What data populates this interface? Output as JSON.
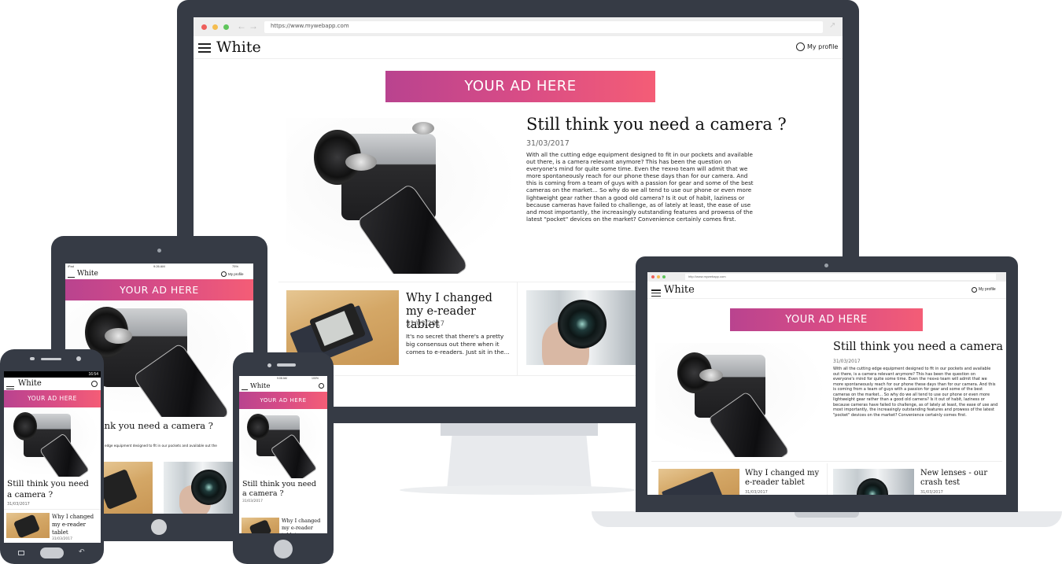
{
  "background_color": "#ffffff",
  "accent": {
    "ad_gradient_start": "#b9438f",
    "ad_gradient_end": "#f45d76",
    "device_frame": "#363b45"
  },
  "desktop": {
    "browser": {
      "url": "https://www.mywebapp.com",
      "traffic_lights": [
        "#ee5f5b",
        "#f5bd4f",
        "#5fc55b"
      ]
    },
    "header": {
      "brand": "White",
      "profile_label": "My profile"
    },
    "ad": {
      "label": "YOUR AD HERE"
    },
    "featured": {
      "title": "Still think you need a camera ?",
      "date": "31/03/2017",
      "body": "With all the cutting edge equipment designed to fit in our pockets and available out there, is a camera relevant anymore? This has been the question on everyone's mind for quite some time. Even the техно team will admit that we more spontaneously reach for our phone these days than for our camera. And this is coming from a team of guys with a passion for gear and some of the best cameras on the market... So why do we all tend to use our phone or even more lightweight gear rather than a good old camera? Is it out of habit, laziness or because cameras have failed to challenge, as of lately at least, the ease of use and most importantly, the increasingly outstanding features and prowess of the latest \"pocket\" devices on the market? Convenience certainly comes first."
    },
    "cards": [
      {
        "title": "Why I changed my e-reader tablet",
        "date": "31/03/2017",
        "excerpt": "It's no secret that there's a pretty big consensus out there when it comes to e-readers. Just sit in the..."
      }
    ]
  },
  "laptop": {
    "browser": {
      "url": "http://www.mywebapp.com"
    },
    "header": {
      "brand": "White",
      "profile_label": "My profile"
    },
    "ad": {
      "label": "YOUR AD HERE"
    },
    "featured": {
      "title": "Still think you need a camera ?",
      "date": "31/03/2017",
      "body": "With all the cutting edge equipment designed to fit in our pockets and available out there, is a camera relevant anymore? This has been the question on everyone's mind for quite some time. Even the техно team will admit that we more spontaneously reach for our phone these days than for our camera. And this is coming from a team of guys with a passion for gear and some of the best cameras on the market... So why do we all tend to use our phone or even more lightweight gear rather than a good old camera? Is it out of habit, laziness or because cameras have failed to challenge, as of lately at least, the ease of use and most importantly, the increasingly outstanding features and prowess of the latest \"pocket\" devices on the market? Convenience certainly comes first."
    },
    "cards": [
      {
        "title": "Why I changed my e-reader tablet",
        "date": "31/03/2017"
      },
      {
        "title": "New lenses - our crash test",
        "date": "31/03/2017"
      }
    ]
  },
  "tablet": {
    "status_bar": {
      "carrier": "iPad",
      "time": "9:26 AM",
      "battery": "75%"
    },
    "header": {
      "brand": "White",
      "profile_label": "My profile"
    },
    "ad": {
      "label": "YOUR AD HERE"
    },
    "featured": {
      "title_partial": "ink you need a camera ?",
      "body_partial": "g edge equipment designed to fit in our pockets and available out the"
    }
  },
  "android_phone": {
    "status_bar": {
      "time": "16:54"
    },
    "header": {
      "brand": "White"
    },
    "ad": {
      "label": "YOUR AD HERE"
    },
    "featured": {
      "title": "Still think you need a camera ?",
      "date": "31/03/2017"
    },
    "cards": [
      {
        "title": "Why I changed my e-reader tablet",
        "date": "31/03/2017"
      }
    ]
  },
  "iphone": {
    "status_bar": {
      "time": "9:08 AM",
      "battery": "100%"
    },
    "header": {
      "brand": "White"
    },
    "ad": {
      "label": "YOUR AD HERE"
    },
    "featured": {
      "title": "Still think you need a camera ?",
      "date": "31/03/2017"
    },
    "cards": [
      {
        "title": "Why I changed my e-reader tablet"
      }
    ]
  }
}
